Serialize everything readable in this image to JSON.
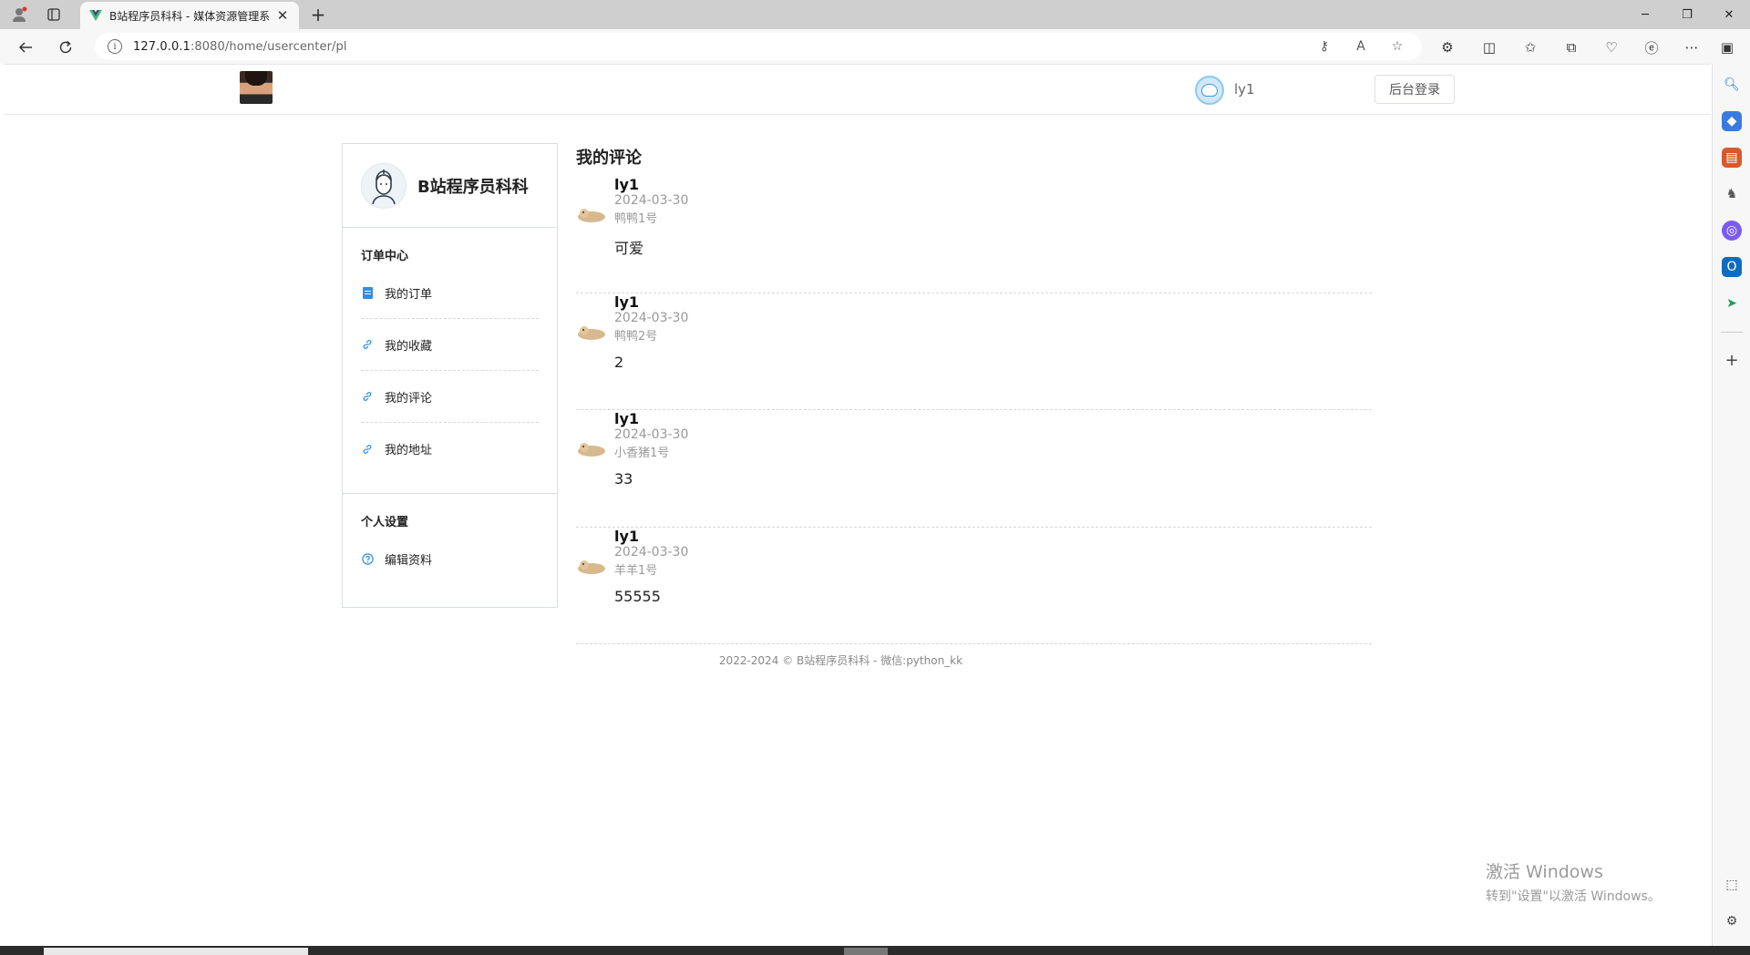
{
  "browser": {
    "tab_title": "B站程序员科科 - 媒体资源管理系",
    "tab_close": "✕",
    "new_tab": "+",
    "url_host": "127.0.0.1",
    "url_path": ":8080/home/usercenter/pl",
    "window_controls": [
      "─",
      "❐",
      "✕"
    ]
  },
  "header": {
    "user_name": "ly1",
    "admin_login": "后台登录"
  },
  "sidebar": {
    "brand_name": "B站程序员科科",
    "groups": [
      {
        "title": "订单中心",
        "items": [
          {
            "label": "我的订单",
            "icon": "document-icon"
          },
          {
            "label": "我的收藏",
            "icon": "link-icon"
          },
          {
            "label": "我的评论",
            "icon": "link-icon"
          },
          {
            "label": "我的地址",
            "icon": "link-icon"
          }
        ]
      },
      {
        "title": "个人设置",
        "items": [
          {
            "label": "编辑资料",
            "icon": "info-circle-icon"
          }
        ]
      }
    ]
  },
  "comments": {
    "title": "我的评论",
    "items": [
      {
        "user": "ly1",
        "date": "2024-03-30",
        "target": "鸭鸭1号",
        "text": "可爱"
      },
      {
        "user": "ly1",
        "date": "2024-03-30",
        "target": "鸭鸭2号",
        "text": "2"
      },
      {
        "user": "ly1",
        "date": "2024-03-30",
        "target": "小香猪1号",
        "text": "33"
      },
      {
        "user": "ly1",
        "date": "2024-03-30",
        "target": "羊羊1号",
        "text": "55555"
      }
    ]
  },
  "footer": {
    "text": "2022-2024 © B站程序员科科 - 微信:python_kk"
  },
  "watermark": {
    "title": "激活 Windows",
    "subtitle": "转到\"设置\"以激活 Windows。"
  },
  "colors": {
    "accent": "#2c8ee8",
    "border": "#d9dde3",
    "muted_text": "#999999"
  }
}
